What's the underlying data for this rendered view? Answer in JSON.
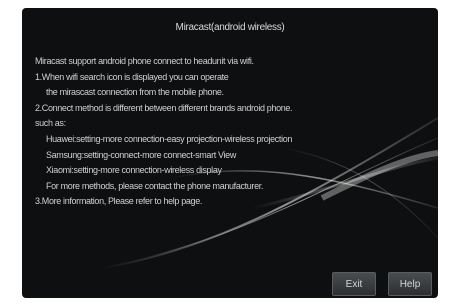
{
  "dialog": {
    "title": "Miracast(android wireless)",
    "lines": [
      "Miracast support android phone connect to headunit via wifi.",
      "1.When wifi search icon is displayed you can operate",
      "the mirascast connection from the mobile phone.",
      "2.Connect method is different between different brands android phone.",
      "such as:",
      "Huawei:setting-more connection-easy projection-wireless projection",
      "Samsung:setting-connect-more connect-smart View",
      "Xiaomi:setting-more connection-wireless display",
      "For more methods, please contact the phone manufacturer.",
      "3.More information, Please refer to help page."
    ],
    "exit_label": "Exit",
    "help_label": "Help"
  }
}
